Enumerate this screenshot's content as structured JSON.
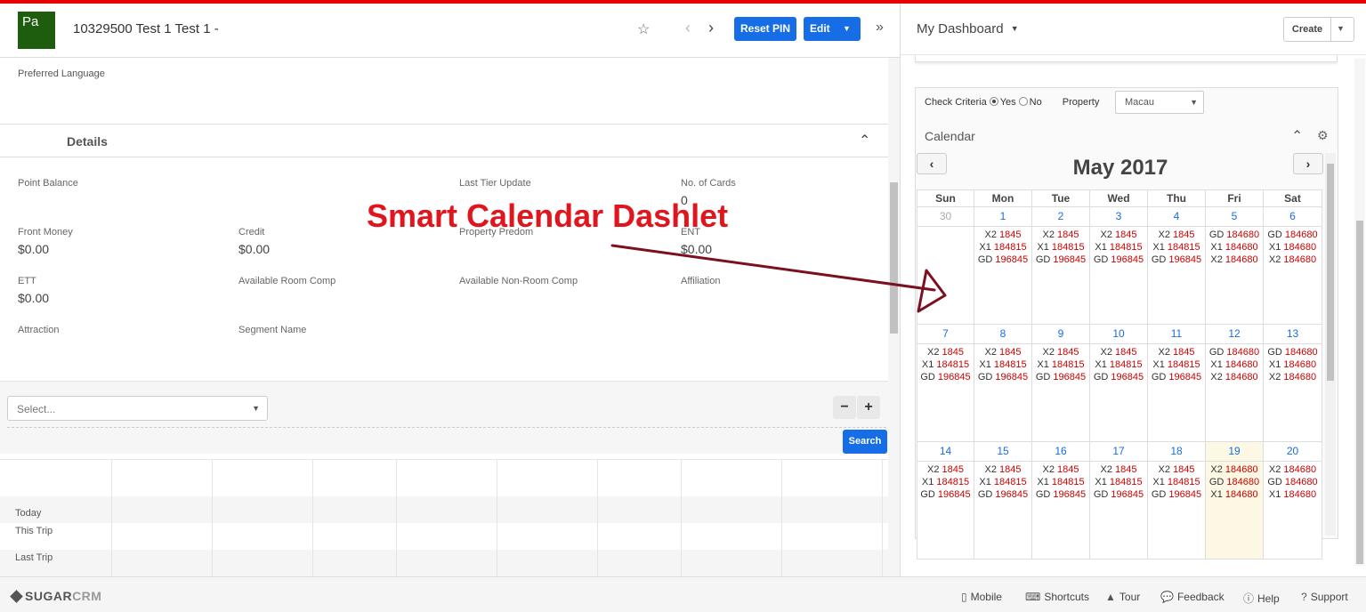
{
  "record": {
    "avatar_initials": "Pa",
    "title": "10329500 Test 1 Test 1 -",
    "reset_pin_label": "Reset PIN",
    "edit_label": "Edit",
    "preferred_language_label": "Preferred Language"
  },
  "details": {
    "title": "Details",
    "fields": {
      "point_balance_label": "Point Balance",
      "last_tier_update_label": "Last Tier Update",
      "no_of_cards_label": "No. of Cards",
      "no_of_cards_value": "0",
      "front_money_label": "Front Money",
      "front_money_value": "$0.00",
      "credit_label": "Credit",
      "credit_value": "$0.00",
      "property_predom_label": "Property Predom",
      "ent_label": "ENT",
      "ent_value": "$0.00",
      "ett_label": "ETT",
      "ett_value": "$0.00",
      "available_room_comp_label": "Available Room Comp",
      "available_nonroom_comp_label": "Available Non-Room Comp",
      "affiliation_label": "Affiliation",
      "attraction_label": "Attraction",
      "segment_name_label": "Segment Name"
    }
  },
  "annotation": {
    "text": "Smart Calendar Dashlet",
    "color": "#e0161e",
    "arrow_color": "#7a1020"
  },
  "filter": {
    "select_placeholder": "Select...",
    "minus_label": "−",
    "plus_label": "+",
    "search_label": "Search"
  },
  "grid_rows": {
    "today": "Today",
    "this_trip": "This Trip",
    "last_trip": "Last Trip"
  },
  "dashboard": {
    "title": "My Dashboard",
    "create_label": "Create"
  },
  "calendar_dashlet": {
    "check_criteria_label": "Check Criteria",
    "yes_label": "Yes",
    "no_label": "No",
    "selected_criteria": "Yes",
    "property_label": "Property",
    "property_value": "Macau",
    "title": "Calendar",
    "month_title": "May 2017",
    "weekdays": [
      "Sun",
      "Mon",
      "Tue",
      "Wed",
      "Thu",
      "Fri",
      "Sat"
    ],
    "weeks": [
      [
        {
          "day": "30",
          "other_month": true,
          "events": []
        },
        {
          "day": "1",
          "events": [
            [
              "X2",
              "1845"
            ],
            [
              "X1",
              "184815"
            ],
            [
              "GD",
              "196845"
            ]
          ]
        },
        {
          "day": "2",
          "events": [
            [
              "X2",
              "1845"
            ],
            [
              "X1",
              "184815"
            ],
            [
              "GD",
              "196845"
            ]
          ]
        },
        {
          "day": "3",
          "events": [
            [
              "X2",
              "1845"
            ],
            [
              "X1",
              "184815"
            ],
            [
              "GD",
              "196845"
            ]
          ]
        },
        {
          "day": "4",
          "events": [
            [
              "X2",
              "1845"
            ],
            [
              "X1",
              "184815"
            ],
            [
              "GD",
              "196845"
            ]
          ]
        },
        {
          "day": "5",
          "events": [
            [
              "GD",
              "184680"
            ],
            [
              "X1",
              "184680"
            ],
            [
              "X2",
              "184680"
            ]
          ]
        },
        {
          "day": "6",
          "events": [
            [
              "GD",
              "184680"
            ],
            [
              "X1",
              "184680"
            ],
            [
              "X2",
              "184680"
            ]
          ]
        }
      ],
      [
        {
          "day": "7",
          "events": [
            [
              "X2",
              "1845"
            ],
            [
              "X1",
              "184815"
            ],
            [
              "GD",
              "196845"
            ]
          ]
        },
        {
          "day": "8",
          "events": [
            [
              "X2",
              "1845"
            ],
            [
              "X1",
              "184815"
            ],
            [
              "GD",
              "196845"
            ]
          ]
        },
        {
          "day": "9",
          "events": [
            [
              "X2",
              "1845"
            ],
            [
              "X1",
              "184815"
            ],
            [
              "GD",
              "196845"
            ]
          ]
        },
        {
          "day": "10",
          "events": [
            [
              "X2",
              "1845"
            ],
            [
              "X1",
              "184815"
            ],
            [
              "GD",
              "196845"
            ]
          ]
        },
        {
          "day": "11",
          "events": [
            [
              "X2",
              "1845"
            ],
            [
              "X1",
              "184815"
            ],
            [
              "GD",
              "196845"
            ]
          ]
        },
        {
          "day": "12",
          "events": [
            [
              "GD",
              "184680"
            ],
            [
              "X1",
              "184680"
            ],
            [
              "X2",
              "184680"
            ]
          ]
        },
        {
          "day": "13",
          "events": [
            [
              "GD",
              "184680"
            ],
            [
              "X1",
              "184680"
            ],
            [
              "X2",
              "184680"
            ]
          ]
        }
      ],
      [
        {
          "day": "14",
          "events": [
            [
              "X2",
              "1845"
            ],
            [
              "X1",
              "184815"
            ],
            [
              "GD",
              "196845"
            ]
          ]
        },
        {
          "day": "15",
          "events": [
            [
              "X2",
              "1845"
            ],
            [
              "X1",
              "184815"
            ],
            [
              "GD",
              "196845"
            ]
          ]
        },
        {
          "day": "16",
          "events": [
            [
              "X2",
              "1845"
            ],
            [
              "X1",
              "184815"
            ],
            [
              "GD",
              "196845"
            ]
          ]
        },
        {
          "day": "17",
          "events": [
            [
              "X2",
              "1845"
            ],
            [
              "X1",
              "184815"
            ],
            [
              "GD",
              "196845"
            ]
          ]
        },
        {
          "day": "18",
          "events": [
            [
              "X2",
              "1845"
            ],
            [
              "X1",
              "184815"
            ],
            [
              "GD",
              "196845"
            ]
          ]
        },
        {
          "day": "19",
          "today": true,
          "events": [
            [
              "X2",
              "184680"
            ],
            [
              "GD",
              "184680"
            ],
            [
              "X1",
              "184680"
            ]
          ]
        },
        {
          "day": "20",
          "events": [
            [
              "X2",
              "184680"
            ],
            [
              "GD",
              "184680"
            ],
            [
              "X1",
              "184680"
            ]
          ]
        }
      ]
    ]
  },
  "footer": {
    "logo_sugar": "SUGAR",
    "logo_crm": "CRM",
    "mobile": "Mobile",
    "shortcuts": "Shortcuts",
    "tour": "Tour",
    "feedback": "Feedback",
    "help": "Help",
    "support": "Support"
  },
  "colors": {
    "top_bar": "#e60000",
    "primary_button": "#176de5",
    "avatar": "#1e5d0e",
    "event_number": "#cc0000",
    "today_cell": "#fcf8e3"
  },
  "icons": {
    "favorite": "star-icon",
    "previous": "chevron-left-icon",
    "next": "chevron-right-icon",
    "toggle_sidebar": "double-chevron-right-icon",
    "collapse": "chevron-up-icon",
    "settings": "gear-icon"
  }
}
